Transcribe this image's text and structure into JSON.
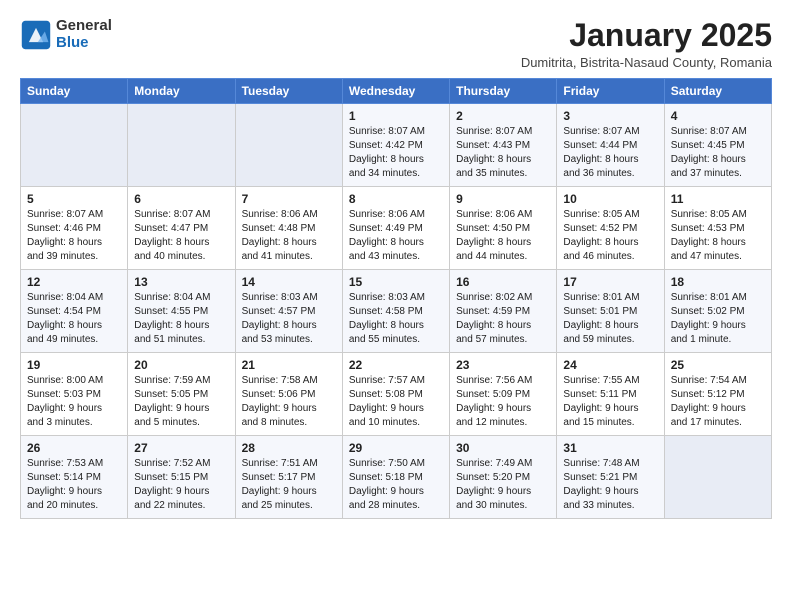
{
  "header": {
    "logo_general": "General",
    "logo_blue": "Blue",
    "title": "January 2025",
    "subtitle": "Dumitrita, Bistrita-Nasaud County, Romania"
  },
  "days_of_week": [
    "Sunday",
    "Monday",
    "Tuesday",
    "Wednesday",
    "Thursday",
    "Friday",
    "Saturday"
  ],
  "weeks": [
    [
      {
        "num": "",
        "info": ""
      },
      {
        "num": "",
        "info": ""
      },
      {
        "num": "",
        "info": ""
      },
      {
        "num": "1",
        "info": "Sunrise: 8:07 AM\nSunset: 4:42 PM\nDaylight: 8 hours\nand 34 minutes."
      },
      {
        "num": "2",
        "info": "Sunrise: 8:07 AM\nSunset: 4:43 PM\nDaylight: 8 hours\nand 35 minutes."
      },
      {
        "num": "3",
        "info": "Sunrise: 8:07 AM\nSunset: 4:44 PM\nDaylight: 8 hours\nand 36 minutes."
      },
      {
        "num": "4",
        "info": "Sunrise: 8:07 AM\nSunset: 4:45 PM\nDaylight: 8 hours\nand 37 minutes."
      }
    ],
    [
      {
        "num": "5",
        "info": "Sunrise: 8:07 AM\nSunset: 4:46 PM\nDaylight: 8 hours\nand 39 minutes."
      },
      {
        "num": "6",
        "info": "Sunrise: 8:07 AM\nSunset: 4:47 PM\nDaylight: 8 hours\nand 40 minutes."
      },
      {
        "num": "7",
        "info": "Sunrise: 8:06 AM\nSunset: 4:48 PM\nDaylight: 8 hours\nand 41 minutes."
      },
      {
        "num": "8",
        "info": "Sunrise: 8:06 AM\nSunset: 4:49 PM\nDaylight: 8 hours\nand 43 minutes."
      },
      {
        "num": "9",
        "info": "Sunrise: 8:06 AM\nSunset: 4:50 PM\nDaylight: 8 hours\nand 44 minutes."
      },
      {
        "num": "10",
        "info": "Sunrise: 8:05 AM\nSunset: 4:52 PM\nDaylight: 8 hours\nand 46 minutes."
      },
      {
        "num": "11",
        "info": "Sunrise: 8:05 AM\nSunset: 4:53 PM\nDaylight: 8 hours\nand 47 minutes."
      }
    ],
    [
      {
        "num": "12",
        "info": "Sunrise: 8:04 AM\nSunset: 4:54 PM\nDaylight: 8 hours\nand 49 minutes."
      },
      {
        "num": "13",
        "info": "Sunrise: 8:04 AM\nSunset: 4:55 PM\nDaylight: 8 hours\nand 51 minutes."
      },
      {
        "num": "14",
        "info": "Sunrise: 8:03 AM\nSunset: 4:57 PM\nDaylight: 8 hours\nand 53 minutes."
      },
      {
        "num": "15",
        "info": "Sunrise: 8:03 AM\nSunset: 4:58 PM\nDaylight: 8 hours\nand 55 minutes."
      },
      {
        "num": "16",
        "info": "Sunrise: 8:02 AM\nSunset: 4:59 PM\nDaylight: 8 hours\nand 57 minutes."
      },
      {
        "num": "17",
        "info": "Sunrise: 8:01 AM\nSunset: 5:01 PM\nDaylight: 8 hours\nand 59 minutes."
      },
      {
        "num": "18",
        "info": "Sunrise: 8:01 AM\nSunset: 5:02 PM\nDaylight: 9 hours\nand 1 minute."
      }
    ],
    [
      {
        "num": "19",
        "info": "Sunrise: 8:00 AM\nSunset: 5:03 PM\nDaylight: 9 hours\nand 3 minutes."
      },
      {
        "num": "20",
        "info": "Sunrise: 7:59 AM\nSunset: 5:05 PM\nDaylight: 9 hours\nand 5 minutes."
      },
      {
        "num": "21",
        "info": "Sunrise: 7:58 AM\nSunset: 5:06 PM\nDaylight: 9 hours\nand 8 minutes."
      },
      {
        "num": "22",
        "info": "Sunrise: 7:57 AM\nSunset: 5:08 PM\nDaylight: 9 hours\nand 10 minutes."
      },
      {
        "num": "23",
        "info": "Sunrise: 7:56 AM\nSunset: 5:09 PM\nDaylight: 9 hours\nand 12 minutes."
      },
      {
        "num": "24",
        "info": "Sunrise: 7:55 AM\nSunset: 5:11 PM\nDaylight: 9 hours\nand 15 minutes."
      },
      {
        "num": "25",
        "info": "Sunrise: 7:54 AM\nSunset: 5:12 PM\nDaylight: 9 hours\nand 17 minutes."
      }
    ],
    [
      {
        "num": "26",
        "info": "Sunrise: 7:53 AM\nSunset: 5:14 PM\nDaylight: 9 hours\nand 20 minutes."
      },
      {
        "num": "27",
        "info": "Sunrise: 7:52 AM\nSunset: 5:15 PM\nDaylight: 9 hours\nand 22 minutes."
      },
      {
        "num": "28",
        "info": "Sunrise: 7:51 AM\nSunset: 5:17 PM\nDaylight: 9 hours\nand 25 minutes."
      },
      {
        "num": "29",
        "info": "Sunrise: 7:50 AM\nSunset: 5:18 PM\nDaylight: 9 hours\nand 28 minutes."
      },
      {
        "num": "30",
        "info": "Sunrise: 7:49 AM\nSunset: 5:20 PM\nDaylight: 9 hours\nand 30 minutes."
      },
      {
        "num": "31",
        "info": "Sunrise: 7:48 AM\nSunset: 5:21 PM\nDaylight: 9 hours\nand 33 minutes."
      },
      {
        "num": "",
        "info": ""
      }
    ]
  ]
}
